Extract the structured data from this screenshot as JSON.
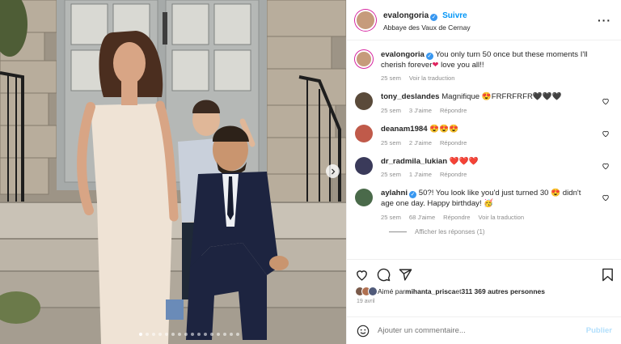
{
  "post": {
    "username": "evalongoria",
    "follow_label": "Suivre",
    "location": "Abbaye des Vaux de Cernay"
  },
  "caption": {
    "username": "evalongoria",
    "text": "You only turn 50 once but these moments I'll cherish forever",
    "text_end": " love you all!!",
    "time": "25 sem",
    "translate": "Voir la traduction"
  },
  "comments": [
    {
      "username": "tony_deslandes",
      "text": "Magnifique 😍FRFRFRFR🖤🖤🖤",
      "time": "25 sem",
      "likes": "3 J'aime",
      "reply": "Répondre",
      "avatar_color": "#5a4a3a"
    },
    {
      "username": "deanam1984",
      "text": "😍😍😍",
      "time": "25 sem",
      "likes": "2 J'aime",
      "reply": "Répondre",
      "avatar_color": "#c05a4a"
    },
    {
      "username": "dr_radmila_lukian",
      "text": "❤️❤️❤️",
      "time": "25 sem",
      "likes": "1 J'aime",
      "reply": "Répondre",
      "avatar_color": "#3a3a5a"
    },
    {
      "username": "aylahni",
      "text": "50?! You look like you'd just turned 30 😍 didn't age one day. Happy birthday! 🥳",
      "time": "25 sem",
      "likes": "68 J'aime",
      "reply": "Répondre",
      "translate": "Voir la traduction",
      "avatar_color": "#4a6a4a"
    }
  ],
  "replies_label": "Afficher les réponses (1)",
  "likes": {
    "prefix": "Aimé par ",
    "user": "mihanta_prisca",
    "middle": " et ",
    "count": "311 369 autres personnes",
    "date": "19 avril"
  },
  "add_comment": {
    "placeholder": "Ajouter un commentaire...",
    "publish": "Publier"
  },
  "icons": {
    "like": "heart-icon",
    "comment": "comment-icon",
    "share": "send-icon",
    "save": "bookmark-icon",
    "emoji": "emoji-icon",
    "more": "more-icon",
    "next": "chevron-right-icon"
  },
  "colors": {
    "accent": "#0095f6",
    "muted": "#8e8e8e",
    "verified": "#3897f0"
  }
}
